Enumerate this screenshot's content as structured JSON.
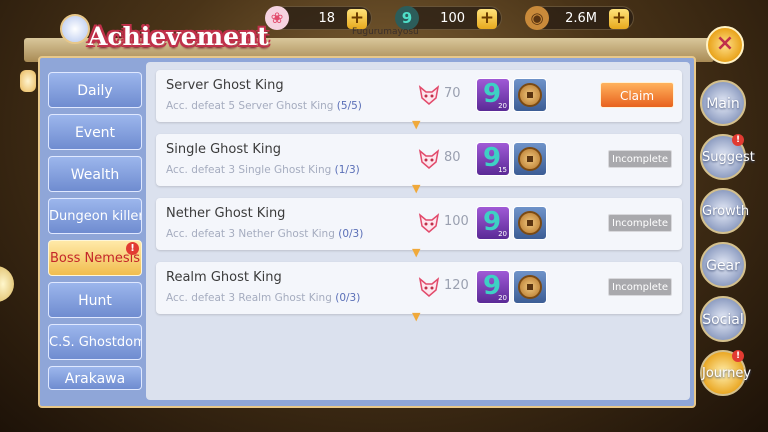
{
  "currencies": [
    {
      "icon": "fox-gem-icon",
      "value": "18"
    },
    {
      "icon": "jade-magatama-icon",
      "value": "100"
    },
    {
      "icon": "coin-icon",
      "value": "2.6M"
    }
  ],
  "username": "Fugurumayosu",
  "panel": {
    "title": "Achievement",
    "close_label": "×"
  },
  "tabs": [
    {
      "label": "Daily",
      "active": false,
      "alert": false
    },
    {
      "label": "Event",
      "active": false,
      "alert": false
    },
    {
      "label": "Wealth",
      "active": false,
      "alert": false
    },
    {
      "label": "Dungeon killer",
      "active": false,
      "alert": false
    },
    {
      "label": "Boss Nemesis",
      "active": true,
      "alert": true
    },
    {
      "label": "Hunt",
      "active": false,
      "alert": false
    },
    {
      "label": "C.S. Ghostdom",
      "active": false,
      "alert": false
    },
    {
      "label": "Arakawa",
      "active": false,
      "alert": false
    }
  ],
  "alert_mark": "!",
  "achievements": [
    {
      "name": "Server Ghost King",
      "desc": "Acc. defeat 5 Server Ghost King",
      "progress": "(5/5)",
      "points": "70",
      "gem_qty": "20",
      "status": "Claim"
    },
    {
      "name": "Single Ghost King",
      "desc": "Acc. defeat 3 Single Ghost King",
      "progress": "(1/3)",
      "points": "80",
      "gem_qty": "15",
      "status": "Incomplete"
    },
    {
      "name": "Nether Ghost King",
      "desc": "Acc. defeat 3 Nether Ghost King",
      "progress": "(0/3)",
      "points": "100",
      "gem_qty": "20",
      "status": "Incomplete"
    },
    {
      "name": "Realm Ghost King",
      "desc": "Acc. defeat 3 Realm Ghost King",
      "progress": "(0/3)",
      "points": "120",
      "gem_qty": "20",
      "status": "Incomplete"
    }
  ],
  "right_menu": [
    {
      "label": "Main",
      "active": false,
      "alert": false
    },
    {
      "label": "Suggest",
      "active": false,
      "alert": true
    },
    {
      "label": "Growth",
      "active": false,
      "alert": false
    },
    {
      "label": "Gear",
      "active": false,
      "alert": false
    },
    {
      "label": "Social",
      "active": false,
      "alert": false
    },
    {
      "label": "Journey",
      "active": true,
      "alert": true
    }
  ],
  "colors": {
    "accent": "#c0304a",
    "claim": "#e8621e",
    "incomplete": "#a9a9ad",
    "tab": "#7f9be0",
    "tab_active": "#f1bd4e"
  }
}
